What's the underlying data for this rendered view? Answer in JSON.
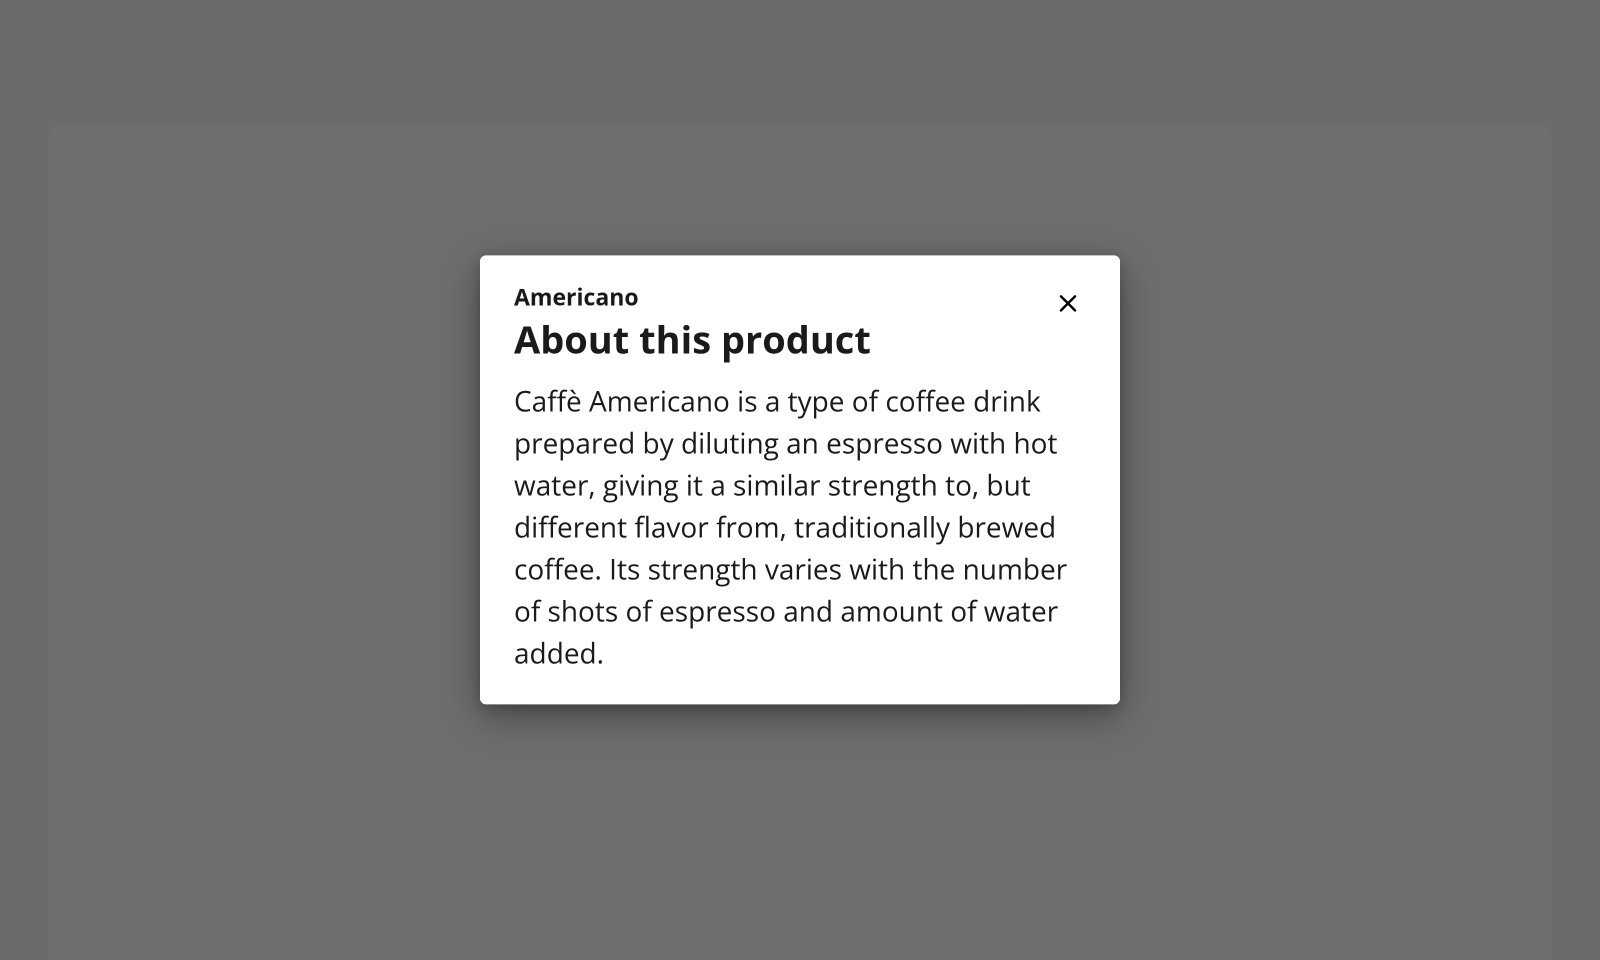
{
  "dialog": {
    "subtitle": "Americano",
    "title": "About this product",
    "body": "Caffè Americano is a type of coffee drink prepared by diluting an espresso with hot water, giving it a similar strength to, but different flavor from, traditionally brewed coffee. Its strength varies with the number of shots of espresso and amount of water added.",
    "close_icon": "close-icon"
  }
}
